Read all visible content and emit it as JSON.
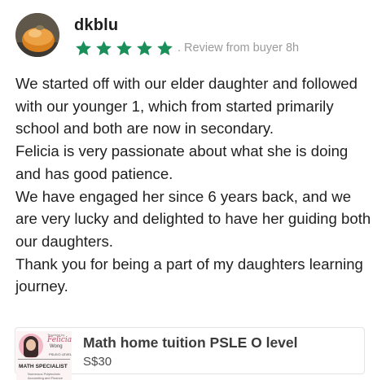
{
  "review": {
    "username": "dkblu",
    "rating": 5,
    "meta": ". Review from buyer  8h",
    "paragraphs": [
      "We started off with our elder daughter and followed with our younger 1, which from started primarily school and both are now in secondary.",
      "Felicia is very passionate about what she is doing  and has good patience.",
      "We have engaged her since 6 years back, and we are very lucky and delighted to have her guiding both our daughters.",
      "Thank you for being a part of my daughters learning journey."
    ]
  },
  "listing": {
    "title": "Math home tuition PSLE O level",
    "price": "S$30",
    "thumbnail": {
      "small_text": "Teaching by",
      "name": "Felicia",
      "surname": "Wong",
      "tag": "PSLE/O LEVEL",
      "heading": "MATH SPECIALIST",
      "sub_line_1": "Teaching from 2014",
      "sub_line_2": "Numerous Polytechnic",
      "sub_line_3": "Accounting and Finance"
    }
  },
  "colors": {
    "star": "#1a8f5a",
    "meta": "#9a9a9a",
    "text": "#1f1f1f"
  },
  "icons": {
    "avatar": "user-avatar-photo",
    "star": "star-icon"
  }
}
